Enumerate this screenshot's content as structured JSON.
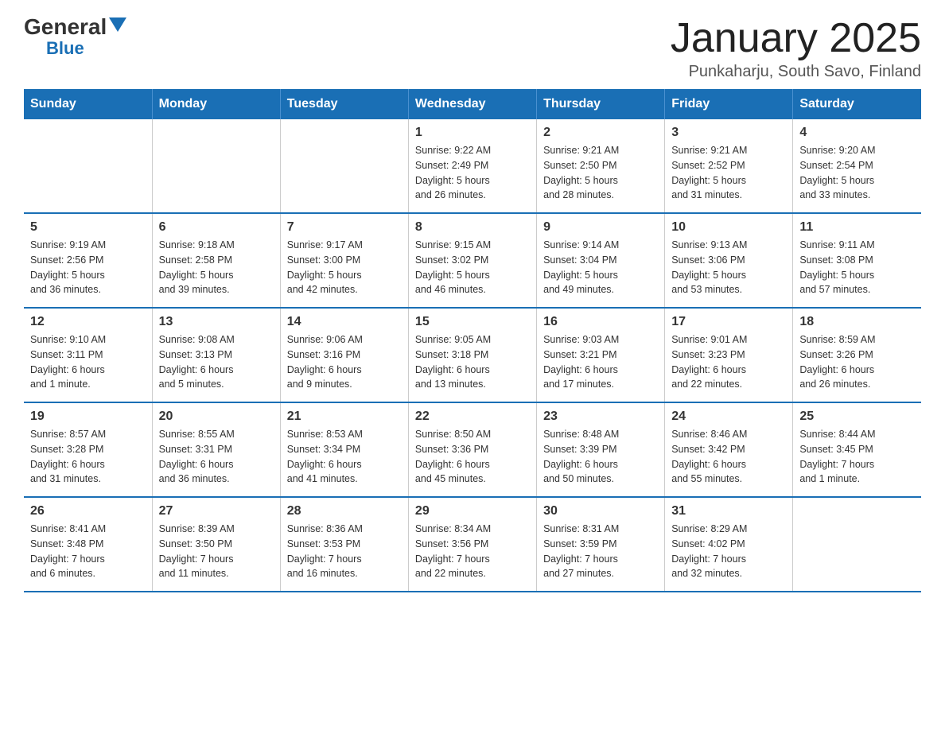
{
  "logo": {
    "general": "General",
    "triangle": "▶",
    "blue": "Blue"
  },
  "title": "January 2025",
  "location": "Punkaharju, South Savo, Finland",
  "days_of_week": [
    "Sunday",
    "Monday",
    "Tuesday",
    "Wednesday",
    "Thursday",
    "Friday",
    "Saturday"
  ],
  "weeks": [
    [
      {
        "day": "",
        "info": ""
      },
      {
        "day": "",
        "info": ""
      },
      {
        "day": "",
        "info": ""
      },
      {
        "day": "1",
        "info": "Sunrise: 9:22 AM\nSunset: 2:49 PM\nDaylight: 5 hours\nand 26 minutes."
      },
      {
        "day": "2",
        "info": "Sunrise: 9:21 AM\nSunset: 2:50 PM\nDaylight: 5 hours\nand 28 minutes."
      },
      {
        "day": "3",
        "info": "Sunrise: 9:21 AM\nSunset: 2:52 PM\nDaylight: 5 hours\nand 31 minutes."
      },
      {
        "day": "4",
        "info": "Sunrise: 9:20 AM\nSunset: 2:54 PM\nDaylight: 5 hours\nand 33 minutes."
      }
    ],
    [
      {
        "day": "5",
        "info": "Sunrise: 9:19 AM\nSunset: 2:56 PM\nDaylight: 5 hours\nand 36 minutes."
      },
      {
        "day": "6",
        "info": "Sunrise: 9:18 AM\nSunset: 2:58 PM\nDaylight: 5 hours\nand 39 minutes."
      },
      {
        "day": "7",
        "info": "Sunrise: 9:17 AM\nSunset: 3:00 PM\nDaylight: 5 hours\nand 42 minutes."
      },
      {
        "day": "8",
        "info": "Sunrise: 9:15 AM\nSunset: 3:02 PM\nDaylight: 5 hours\nand 46 minutes."
      },
      {
        "day": "9",
        "info": "Sunrise: 9:14 AM\nSunset: 3:04 PM\nDaylight: 5 hours\nand 49 minutes."
      },
      {
        "day": "10",
        "info": "Sunrise: 9:13 AM\nSunset: 3:06 PM\nDaylight: 5 hours\nand 53 minutes."
      },
      {
        "day": "11",
        "info": "Sunrise: 9:11 AM\nSunset: 3:08 PM\nDaylight: 5 hours\nand 57 minutes."
      }
    ],
    [
      {
        "day": "12",
        "info": "Sunrise: 9:10 AM\nSunset: 3:11 PM\nDaylight: 6 hours\nand 1 minute."
      },
      {
        "day": "13",
        "info": "Sunrise: 9:08 AM\nSunset: 3:13 PM\nDaylight: 6 hours\nand 5 minutes."
      },
      {
        "day": "14",
        "info": "Sunrise: 9:06 AM\nSunset: 3:16 PM\nDaylight: 6 hours\nand 9 minutes."
      },
      {
        "day": "15",
        "info": "Sunrise: 9:05 AM\nSunset: 3:18 PM\nDaylight: 6 hours\nand 13 minutes."
      },
      {
        "day": "16",
        "info": "Sunrise: 9:03 AM\nSunset: 3:21 PM\nDaylight: 6 hours\nand 17 minutes."
      },
      {
        "day": "17",
        "info": "Sunrise: 9:01 AM\nSunset: 3:23 PM\nDaylight: 6 hours\nand 22 minutes."
      },
      {
        "day": "18",
        "info": "Sunrise: 8:59 AM\nSunset: 3:26 PM\nDaylight: 6 hours\nand 26 minutes."
      }
    ],
    [
      {
        "day": "19",
        "info": "Sunrise: 8:57 AM\nSunset: 3:28 PM\nDaylight: 6 hours\nand 31 minutes."
      },
      {
        "day": "20",
        "info": "Sunrise: 8:55 AM\nSunset: 3:31 PM\nDaylight: 6 hours\nand 36 minutes."
      },
      {
        "day": "21",
        "info": "Sunrise: 8:53 AM\nSunset: 3:34 PM\nDaylight: 6 hours\nand 41 minutes."
      },
      {
        "day": "22",
        "info": "Sunrise: 8:50 AM\nSunset: 3:36 PM\nDaylight: 6 hours\nand 45 minutes."
      },
      {
        "day": "23",
        "info": "Sunrise: 8:48 AM\nSunset: 3:39 PM\nDaylight: 6 hours\nand 50 minutes."
      },
      {
        "day": "24",
        "info": "Sunrise: 8:46 AM\nSunset: 3:42 PM\nDaylight: 6 hours\nand 55 minutes."
      },
      {
        "day": "25",
        "info": "Sunrise: 8:44 AM\nSunset: 3:45 PM\nDaylight: 7 hours\nand 1 minute."
      }
    ],
    [
      {
        "day": "26",
        "info": "Sunrise: 8:41 AM\nSunset: 3:48 PM\nDaylight: 7 hours\nand 6 minutes."
      },
      {
        "day": "27",
        "info": "Sunrise: 8:39 AM\nSunset: 3:50 PM\nDaylight: 7 hours\nand 11 minutes."
      },
      {
        "day": "28",
        "info": "Sunrise: 8:36 AM\nSunset: 3:53 PM\nDaylight: 7 hours\nand 16 minutes."
      },
      {
        "day": "29",
        "info": "Sunrise: 8:34 AM\nSunset: 3:56 PM\nDaylight: 7 hours\nand 22 minutes."
      },
      {
        "day": "30",
        "info": "Sunrise: 8:31 AM\nSunset: 3:59 PM\nDaylight: 7 hours\nand 27 minutes."
      },
      {
        "day": "31",
        "info": "Sunrise: 8:29 AM\nSunset: 4:02 PM\nDaylight: 7 hours\nand 32 minutes."
      },
      {
        "day": "",
        "info": ""
      }
    ]
  ]
}
